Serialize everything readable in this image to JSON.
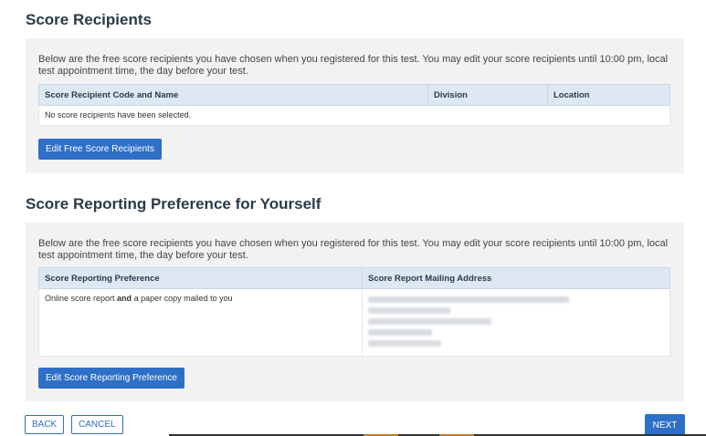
{
  "score_recipients": {
    "title": "Score Recipients",
    "intro": "Below are the free score recipients you have chosen when you registered for this test. You may edit your score recipients until 10:00 pm, local test appointment time, the day before your test.",
    "columns": [
      "Score Recipient Code and Name",
      "Division",
      "Location"
    ],
    "empty_message": "No score recipients have been selected.",
    "edit_button": "Edit Free Score Recipients"
  },
  "score_reporting": {
    "title": "Score Reporting Preference for Yourself",
    "intro": "Below are the free score recipients you have chosen when you registered for this test. You may edit your score recipients until 10:00 pm, local test appointment time, the day before your test.",
    "columns": [
      "Score Reporting Preference",
      "Score Report Mailing Address"
    ],
    "preference": {
      "prefix": "Online score report ",
      "bold": "and",
      "suffix": " a paper copy mailed to you"
    },
    "edit_button": "Edit Score Reporting Preference"
  },
  "nav": {
    "back": "BACK",
    "cancel": "CANCEL",
    "next": "NEXT"
  }
}
